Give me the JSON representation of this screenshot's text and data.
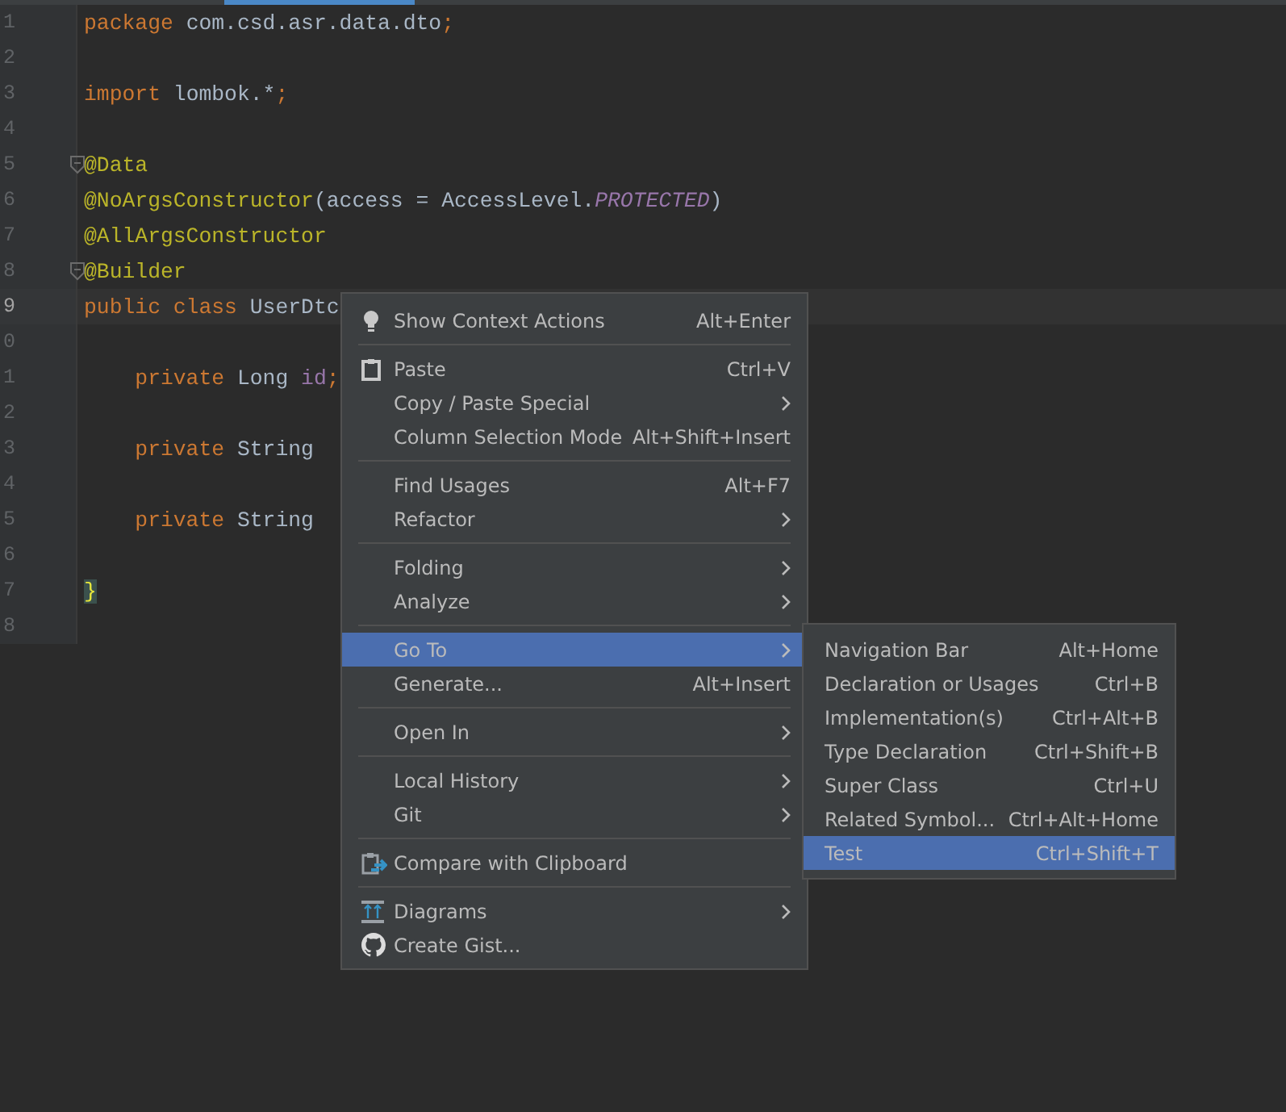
{
  "editor": {
    "lines": [
      {
        "number": "1",
        "current": false,
        "tokens": [
          {
            "text": "package ",
            "kind": "keyword"
          },
          {
            "text": "com.csd.asr.data.dto",
            "kind": "plain"
          },
          {
            "text": ";",
            "kind": "keyword"
          }
        ]
      },
      {
        "number": "2",
        "current": false
      },
      {
        "number": "3",
        "current": false,
        "tokens": [
          {
            "text": "import ",
            "kind": "keyword"
          },
          {
            "text": "lombok.*",
            "kind": "plain"
          },
          {
            "text": ";",
            "kind": "keyword"
          }
        ]
      },
      {
        "number": "4",
        "current": false
      },
      {
        "number": "5",
        "current": false,
        "fold": true,
        "tokens": [
          {
            "text": "@Data",
            "kind": "annotation"
          }
        ]
      },
      {
        "number": "6",
        "current": false,
        "tokens": [
          {
            "text": "@NoArgsConstructor",
            "kind": "annotation"
          },
          {
            "text": "(access = AccessLevel.",
            "kind": "plain"
          },
          {
            "text": "PROTECTED",
            "kind": "constant"
          },
          {
            "text": ")",
            "kind": "plain"
          }
        ]
      },
      {
        "number": "7",
        "current": false,
        "tokens": [
          {
            "text": "@AllArgsConstructor",
            "kind": "annotation"
          }
        ]
      },
      {
        "number": "8",
        "current": false,
        "fold": true,
        "tokens": [
          {
            "text": "@Builder",
            "kind": "annotation"
          }
        ]
      },
      {
        "number": "9",
        "current": true,
        "tokens": [
          {
            "text": "public class ",
            "kind": "keyword"
          },
          {
            "text": "UserDtc",
            "kind": "plain"
          }
        ]
      },
      {
        "number": "0",
        "current": false
      },
      {
        "number": "1",
        "current": false,
        "tokens": [
          {
            "text": "    private ",
            "kind": "keyword"
          },
          {
            "text": "Long ",
            "kind": "plain"
          },
          {
            "text": "id",
            "kind": "field"
          },
          {
            "text": ";",
            "kind": "keyword"
          }
        ]
      },
      {
        "number": "2",
        "current": false
      },
      {
        "number": "3",
        "current": false,
        "tokens": [
          {
            "text": "    private ",
            "kind": "keyword"
          },
          {
            "text": "String",
            "kind": "plain"
          }
        ]
      },
      {
        "number": "4",
        "current": false
      },
      {
        "number": "5",
        "current": false,
        "tokens": [
          {
            "text": "    private ",
            "kind": "keyword"
          },
          {
            "text": "String",
            "kind": "plain"
          }
        ]
      },
      {
        "number": "6",
        "current": false
      },
      {
        "number": "7",
        "current": false,
        "tokens": [
          {
            "text": "}",
            "kind": "brace"
          }
        ]
      },
      {
        "number": "8",
        "current": false
      }
    ]
  },
  "context_menu": {
    "groups": [
      [
        {
          "kind": "bulb",
          "label": "Show Context Actions",
          "shortcut": "Alt+Enter",
          "submenu": false,
          "selected": false
        }
      ],
      [
        {
          "kind": "clipboard",
          "label": "Paste",
          "shortcut": "Ctrl+V",
          "submenu": false,
          "selected": false
        },
        {
          "kind": "plain",
          "label": "Copy / Paste Special",
          "submenu": true,
          "selected": false
        },
        {
          "kind": "plain",
          "label": "Column Selection Mode",
          "shortcut": "Alt+Shift+Insert",
          "submenu": false,
          "selected": false
        }
      ],
      [
        {
          "kind": "plain",
          "label": "Find Usages",
          "shortcut": "Alt+F7",
          "submenu": false,
          "selected": false
        },
        {
          "kind": "plain",
          "label": "Refactor",
          "submenu": true,
          "selected": false
        }
      ],
      [
        {
          "kind": "plain",
          "label": "Folding",
          "submenu": true,
          "selected": false
        },
        {
          "kind": "plain",
          "label": "Analyze",
          "submenu": true,
          "selected": false
        }
      ],
      [
        {
          "kind": "plain",
          "label": "Go To",
          "submenu": true,
          "selected": true
        },
        {
          "kind": "plain",
          "label": "Generate...",
          "shortcut": "Alt+Insert",
          "submenu": false,
          "selected": false
        }
      ],
      [
        {
          "kind": "plain",
          "label": "Open In",
          "submenu": true,
          "selected": false
        }
      ],
      [
        {
          "kind": "plain",
          "label": "Local History",
          "submenu": true,
          "selected": false
        },
        {
          "kind": "plain",
          "label": "Git",
          "submenu": true,
          "selected": false
        }
      ],
      [
        {
          "kind": "compare",
          "label": "Compare with Clipboard",
          "submenu": false,
          "selected": false
        }
      ],
      [
        {
          "kind": "diagram",
          "label": "Diagrams",
          "submenu": true,
          "selected": false
        },
        {
          "kind": "github",
          "label": "Create Gist...",
          "submenu": false,
          "selected": false
        }
      ]
    ]
  },
  "submenu": {
    "items": [
      {
        "label": "Navigation Bar",
        "shortcut": "Alt+Home",
        "selected": false
      },
      {
        "label": "Declaration or Usages",
        "shortcut": "Ctrl+B",
        "selected": false
      },
      {
        "label": "Implementation(s)",
        "shortcut": "Ctrl+Alt+B",
        "selected": false
      },
      {
        "label": "Type Declaration",
        "shortcut": "Ctrl+Shift+B",
        "selected": false
      },
      {
        "label": "Super Class",
        "shortcut": "Ctrl+U",
        "selected": false
      },
      {
        "label": "Related Symbol...",
        "shortcut": "Ctrl+Alt+Home",
        "selected": false
      },
      {
        "label": "Test",
        "shortcut": "Ctrl+Shift+T",
        "selected": true
      }
    ]
  }
}
